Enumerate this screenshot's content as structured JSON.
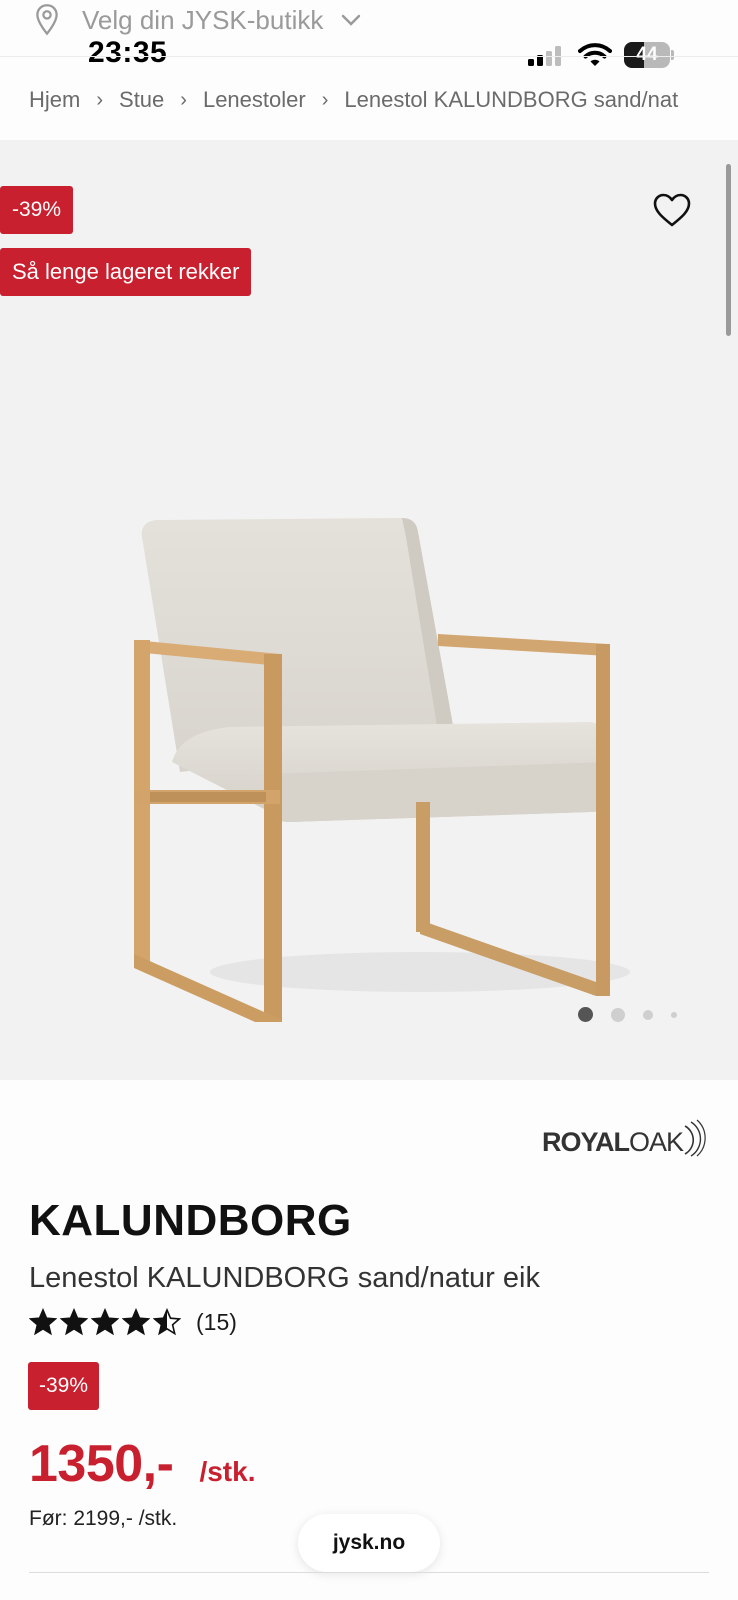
{
  "store_selector": {
    "label": "Velg din JYSK-butikk"
  },
  "status_bar": {
    "time": "23:35",
    "battery": "44",
    "battery_level": 0.44
  },
  "breadcrumb": [
    "Hjem",
    "Stue",
    "Lenestoler",
    "Lenestol KALUNDBORG sand/nat"
  ],
  "gallery": {
    "discount_badge": "-39%",
    "stock_badge": "Så lenge lageret rekker",
    "image_count": 4,
    "active_index": 0
  },
  "product": {
    "brand": {
      "part1": "ROYAL",
      "part2": "OAK"
    },
    "name": "KALUNDBORG",
    "description": "Lenestol KALUNDBORG sand/natur eik",
    "rating": 4.5,
    "rating_max": 5,
    "review_count": "(15)",
    "discount_badge": "-39%",
    "price": "1350,-",
    "price_unit": "/stk.",
    "before_price": "Før: 2199,- /stk."
  },
  "browser": {
    "url": "jysk.no"
  },
  "colors": {
    "accent_red": "#c8202f",
    "text": "#1a1a1a",
    "muted": "#9a9a9a",
    "gallery_bg": "#f3f2f2"
  }
}
